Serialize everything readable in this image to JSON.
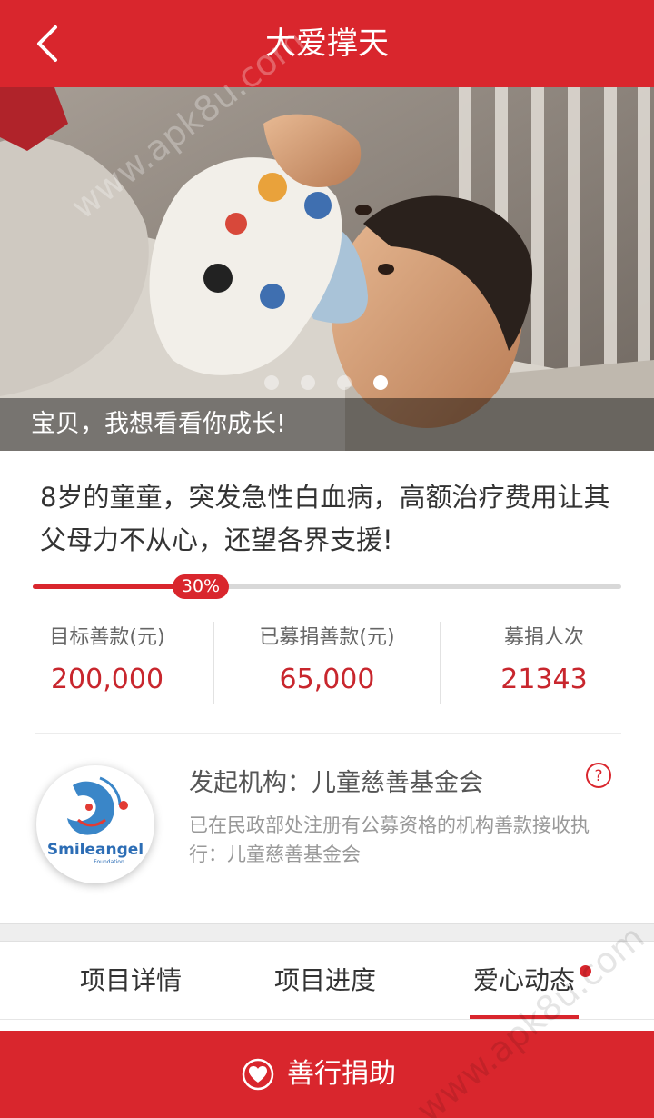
{
  "header": {
    "title": "大爱撑天",
    "back_icon": "chevron-left-icon"
  },
  "banner": {
    "caption": "宝贝，我想看看你成长!",
    "slides_total": 4,
    "active_slide": 4
  },
  "project": {
    "description": "8岁的童童，突发急性白血病，高额治疗费用让其父母力不从心，还望各界支援!",
    "progress_percent": 30,
    "progress_label": "30%"
  },
  "stats": [
    {
      "label": "目标善款(元)",
      "value": "200,000"
    },
    {
      "label": "已募捐善款(元)",
      "value": "65,000"
    },
    {
      "label": "募捐人次",
      "value": "21343"
    }
  ],
  "organization": {
    "title": "发起机构：儿童慈善基金会",
    "description": "已在民政部处注册有公募资格的机构善款接收执行：儿童慈善基金会",
    "logo_text": "Smileangel",
    "logo_subtext": "Foundation",
    "help_icon": "question-circle-icon"
  },
  "tabs": [
    {
      "label": "项目详情",
      "active": false
    },
    {
      "label": "项目进度",
      "active": false
    },
    {
      "label": "爱心动态",
      "active": true,
      "has_badge": true
    }
  ],
  "action": {
    "label": "善行捐助",
    "icon": "heart-icon"
  },
  "watermark": "www.apk8u.com",
  "colors": {
    "brand_red": "#d9262d",
    "value_red": "#c8262d"
  }
}
